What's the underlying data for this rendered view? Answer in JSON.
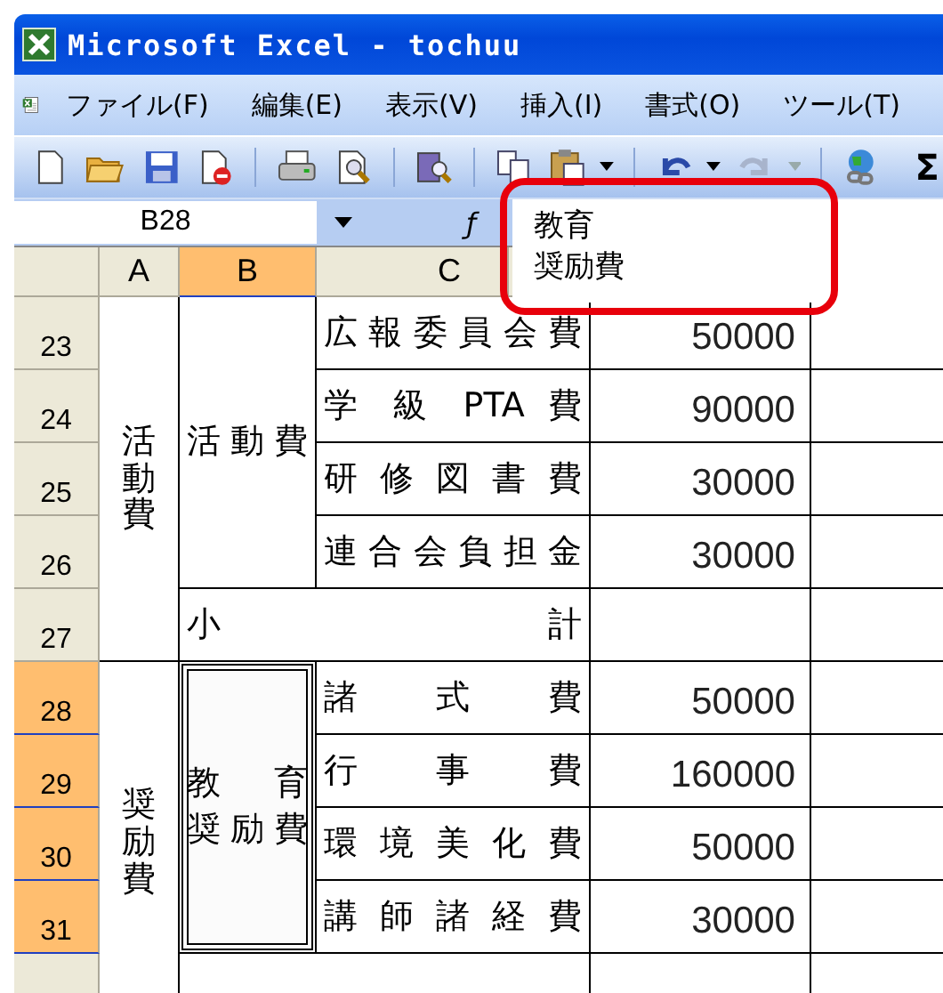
{
  "window": {
    "title": "Microsoft Excel - tochuu"
  },
  "menu": [
    {
      "label": "ファイル(F)"
    },
    {
      "label": "編集(E)"
    },
    {
      "label": "表示(V)"
    },
    {
      "label": "挿入(I)"
    },
    {
      "label": "書式(O)"
    },
    {
      "label": "ツール(T)"
    }
  ],
  "toolbar": {
    "sum_symbol": "Σ"
  },
  "formula_bar": {
    "name_box": "B28",
    "fx_label": "ƒ",
    "formula_lines": [
      "教育",
      "奨励費"
    ]
  },
  "columns": [
    {
      "label": "A",
      "selected": false
    },
    {
      "label": "B",
      "selected": true
    },
    {
      "label": "C",
      "selected": false
    }
  ],
  "row_headers": [
    {
      "label": "23",
      "selected": false
    },
    {
      "label": "24",
      "selected": false
    },
    {
      "label": "25",
      "selected": false
    },
    {
      "label": "26",
      "selected": false
    },
    {
      "label": "27",
      "selected": false
    },
    {
      "label": "28",
      "selected": true
    },
    {
      "label": "29",
      "selected": true
    },
    {
      "label": "30",
      "selected": true
    },
    {
      "label": "31",
      "selected": true
    }
  ],
  "sections": [
    {
      "category": "活動費",
      "subgroup_lines": [
        "活動費"
      ],
      "selected": false,
      "items": [
        {
          "name": "広報委員会費",
          "amount": "50000"
        },
        {
          "name": "学 級 PTA 費",
          "amount": "90000"
        },
        {
          "name": "研修図書費",
          "amount": "30000"
        },
        {
          "name": "連合会負担金",
          "amount": "30000"
        }
      ],
      "subtotal": "小計"
    },
    {
      "category": "奨励費",
      "subgroup_lines": [
        "教育",
        "奨励費"
      ],
      "selected": true,
      "items": [
        {
          "name": "諸式費",
          "amount": "50000"
        },
        {
          "name": "行事費",
          "amount": "160000"
        },
        {
          "name": "環境美化費",
          "amount": "50000"
        },
        {
          "name": "講師諸経費",
          "amount": "30000"
        }
      ]
    }
  ]
}
